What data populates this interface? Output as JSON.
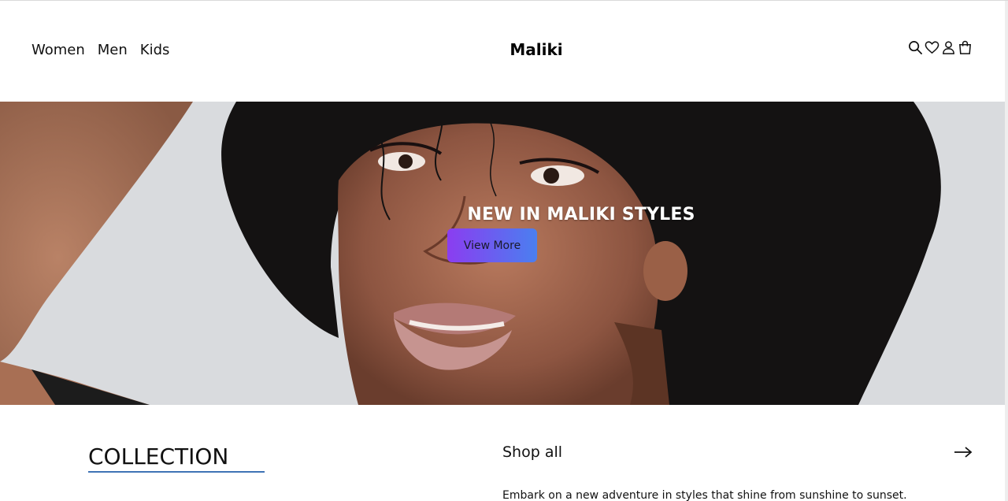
{
  "header": {
    "nav": [
      "Women",
      "Men",
      "Kids"
    ],
    "brand": "Maliki",
    "icons": [
      "search-icon",
      "heart-icon",
      "user-icon",
      "bag-icon"
    ]
  },
  "hero": {
    "title": "NEW IN MALIKI STYLES",
    "button_label": "View More",
    "button_gradient": [
      "#8b3df0",
      "#4a7ff0"
    ]
  },
  "collection": {
    "title": "COLLECTION",
    "shop_all": "Shop all",
    "description": "Embark on a new adventure in styles that shine from sunshine to sunset."
  },
  "colors": {
    "accent_underline": "#3f73b5"
  }
}
